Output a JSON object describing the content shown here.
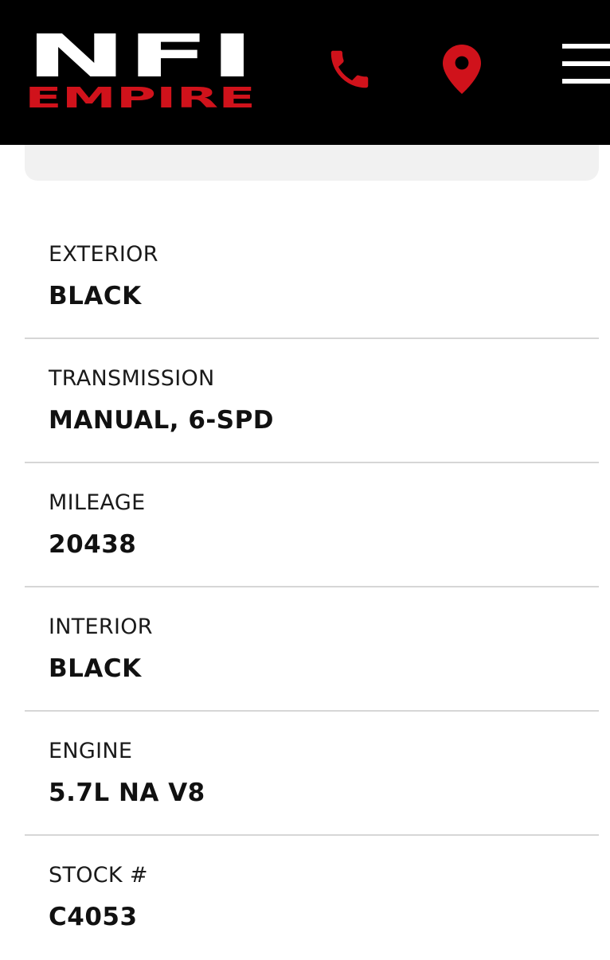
{
  "header": {
    "brand_top": "NFI",
    "brand_bottom": "EMPIRE",
    "icons": [
      "phone-icon",
      "location-pin-icon",
      "hamburger-menu-icon"
    ],
    "colors": {
      "background": "#000000",
      "accent": "#d0121b",
      "logo_white": "#ffffff"
    }
  },
  "specs": [
    {
      "label": "EXTERIOR",
      "value": "BLACK"
    },
    {
      "label": "TRANSMISSION",
      "value": "MANUAL, 6-SPD"
    },
    {
      "label": "MILEAGE",
      "value": "20438"
    },
    {
      "label": "INTERIOR",
      "value": "BLACK"
    },
    {
      "label": "ENGINE",
      "value": "5.7L NA V8"
    },
    {
      "label": "STOCK #",
      "value": "C4053"
    }
  ]
}
